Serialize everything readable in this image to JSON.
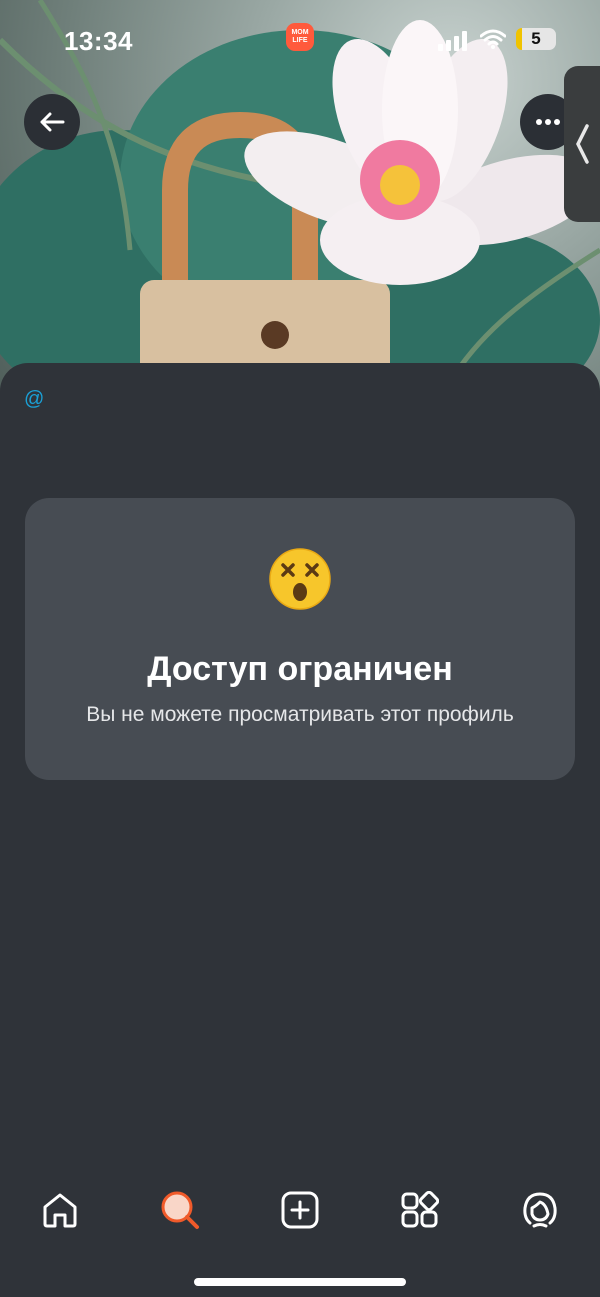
{
  "status_bar": {
    "time": "13:34",
    "battery": "5",
    "app_badge_label": "MOM LIFE"
  },
  "header": {
    "back_icon": "arrow-left-icon",
    "more_icon": "ellipsis-icon",
    "side_tab_icon": "chevron-left-icon"
  },
  "profile": {
    "handle": "@"
  },
  "restricted_card": {
    "emoji": "dizzy-face-emoji",
    "title": "Доступ ограничен",
    "subtitle": "Вы не можете просматривать этот профиль"
  },
  "tab_bar": [
    {
      "icon": "home-icon",
      "active": false
    },
    {
      "icon": "search-icon",
      "active": true
    },
    {
      "icon": "add-icon",
      "active": false
    },
    {
      "icon": "apps-icon",
      "active": false
    },
    {
      "icon": "profile-icon",
      "active": false
    }
  ],
  "colors": {
    "accent": "#1aa0d6",
    "active_tab": "#f05a2a",
    "card": "#474c53",
    "background": "#2f3339"
  }
}
